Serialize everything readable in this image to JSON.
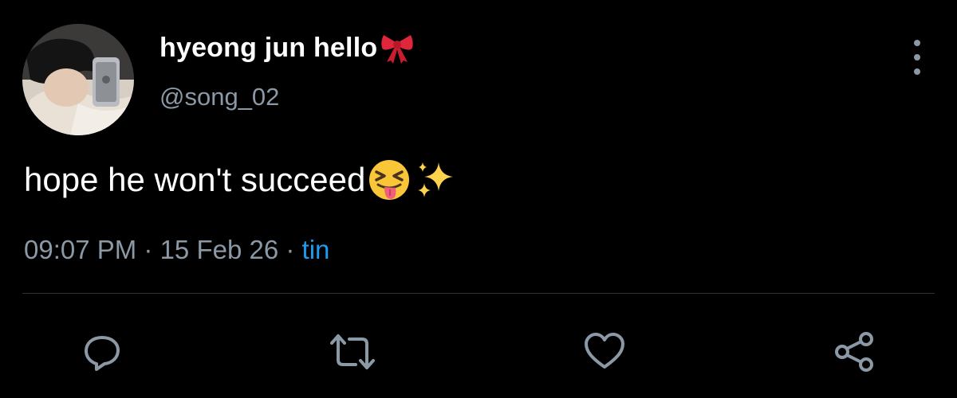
{
  "colors": {
    "background": "#000000",
    "text_primary": "#ffffff",
    "text_secondary": "#8b98a5",
    "link": "#1d9bf0",
    "divider": "#2f3336"
  },
  "author": {
    "display_name": "hyeong jun hello",
    "name_emoji": "ribbon-bow-icon",
    "handle": "@song_02"
  },
  "tweet": {
    "text": "hope he won't succeed",
    "emojis": [
      "squinting-face-with-tongue-icon",
      "sparkles-icon"
    ]
  },
  "meta": {
    "time": "09:07 PM",
    "separator": " · ",
    "date": "15 Feb 26",
    "source": "tin"
  },
  "actions": [
    {
      "name": "reply",
      "icon": "reply-icon"
    },
    {
      "name": "retweet",
      "icon": "retweet-icon"
    },
    {
      "name": "like",
      "icon": "heart-icon"
    },
    {
      "name": "share",
      "icon": "share-icon"
    }
  ]
}
